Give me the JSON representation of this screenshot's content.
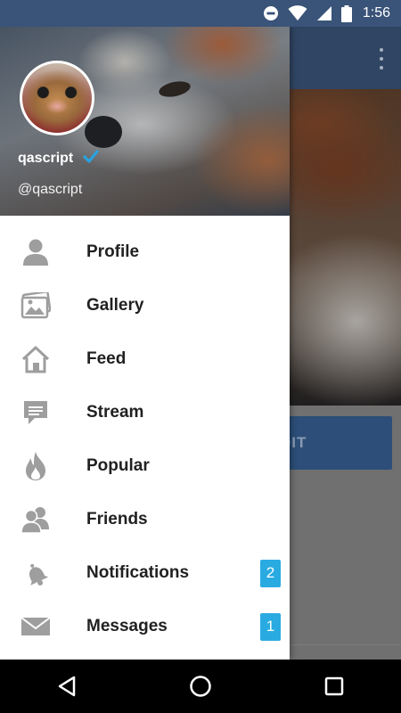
{
  "status_bar": {
    "time": "1:56",
    "icons": [
      "do-not-disturb-icon",
      "wifi-icon",
      "signal-icon",
      "battery-icon"
    ]
  },
  "app": {
    "button_label": "DIT",
    "menu_icon": "overflow-menu-icon"
  },
  "drawer": {
    "user": {
      "name": "qascript",
      "handle": "@qascript",
      "verified_icon": "verified-check-icon"
    },
    "items": [
      {
        "label": "Profile",
        "icon": "person-icon",
        "badge": ""
      },
      {
        "label": "Gallery",
        "icon": "gallery-icon",
        "badge": ""
      },
      {
        "label": "Feed",
        "icon": "home-icon",
        "badge": ""
      },
      {
        "label": "Stream",
        "icon": "chat-bubble-icon",
        "badge": ""
      },
      {
        "label": "Popular",
        "icon": "flame-icon",
        "badge": ""
      },
      {
        "label": "Friends",
        "icon": "friends-icon",
        "badge": ""
      },
      {
        "label": "Notifications",
        "icon": "bell-icon",
        "badge": "2"
      },
      {
        "label": "Messages",
        "icon": "envelope-icon",
        "badge": "1"
      }
    ]
  },
  "nav_bar": {
    "icons": [
      "back-icon",
      "home-circle-icon",
      "recents-icon"
    ]
  },
  "colors": {
    "status_bar": "#3a5378",
    "badge": "#29abe2",
    "icon_gray": "#9e9e9e",
    "label": "#212121"
  }
}
